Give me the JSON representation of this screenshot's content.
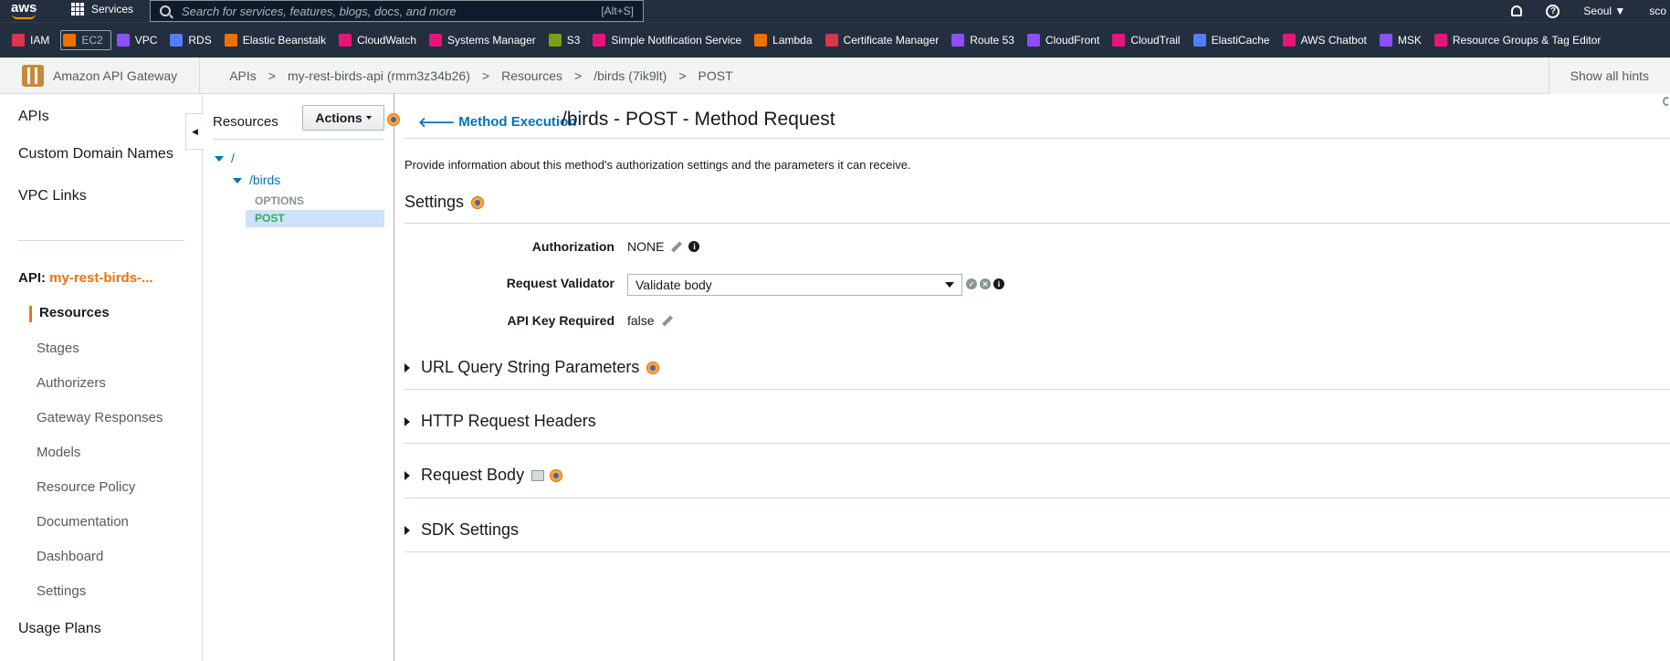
{
  "topnav": {
    "logo": "aws",
    "services_label": "Services",
    "search_placeholder": "Search for services, features, blogs, docs, and more",
    "search_shortcut": "[Alt+S]",
    "region": "Seoul ▼",
    "user": "sco"
  },
  "favorites": [
    {
      "label": "IAM",
      "color": "#dd344c"
    },
    {
      "label": "EC2",
      "color": "#ed7100",
      "active": true
    },
    {
      "label": "VPC",
      "color": "#8c4fff"
    },
    {
      "label": "RDS",
      "color": "#527fff"
    },
    {
      "label": "Elastic Beanstalk",
      "color": "#ed7100"
    },
    {
      "label": "CloudWatch",
      "color": "#e7157b"
    },
    {
      "label": "Systems Manager",
      "color": "#e7157b"
    },
    {
      "label": "S3",
      "color": "#7aa116"
    },
    {
      "label": "Simple Notification Service",
      "color": "#e7157b"
    },
    {
      "label": "Lambda",
      "color": "#ed7100"
    },
    {
      "label": "Certificate Manager",
      "color": "#dd344c"
    },
    {
      "label": "Route 53",
      "color": "#8c4fff"
    },
    {
      "label": "CloudFront",
      "color": "#8c4fff"
    },
    {
      "label": "CloudTrail",
      "color": "#e7157b"
    },
    {
      "label": "ElastiCache",
      "color": "#527fff"
    },
    {
      "label": "AWS Chatbot",
      "color": "#e7157b"
    },
    {
      "label": "MSK",
      "color": "#8c4fff"
    },
    {
      "label": "Resource Groups & Tag Editor",
      "color": "#e7157b"
    }
  ],
  "breadcrumb": {
    "service": "Amazon API Gateway",
    "items": [
      "APIs",
      "my-rest-birds-api (rmm3z34b26)",
      "Resources",
      "/birds (7ik9lt)",
      "POST"
    ],
    "separator": ">",
    "hints_button": "Show all hints"
  },
  "leftnav": {
    "top_items": [
      "APIs",
      "Custom Domain Names",
      "VPC Links"
    ],
    "api_prefix": "API:",
    "api_name": "my-rest-birds-...",
    "sub_items": [
      "Resources",
      "Stages",
      "Authorizers",
      "Gateway Responses",
      "Models",
      "Resource Policy",
      "Documentation",
      "Dashboard",
      "Settings"
    ],
    "bottom_item": "Usage Plans"
  },
  "resources": {
    "title": "Resources",
    "actions_label": "Actions",
    "tree": {
      "root": "/",
      "child": "/birds",
      "methods": [
        "OPTIONS",
        "POST"
      ]
    }
  },
  "main": {
    "back_link": "Method Execution",
    "title": "/birds - POST - Method Request",
    "description": "Provide information about this method's authorization settings and the parameters it can receive.",
    "settings_title": "Settings",
    "fields": {
      "authorization_label": "Authorization",
      "authorization_value": "NONE",
      "validator_label": "Request Validator",
      "validator_value": "Validate body",
      "apikey_label": "API Key Required",
      "apikey_value": "false"
    },
    "sections": [
      "URL Query String Parameters",
      "HTTP Request Headers",
      "Request Body",
      "SDK Settings"
    ]
  }
}
